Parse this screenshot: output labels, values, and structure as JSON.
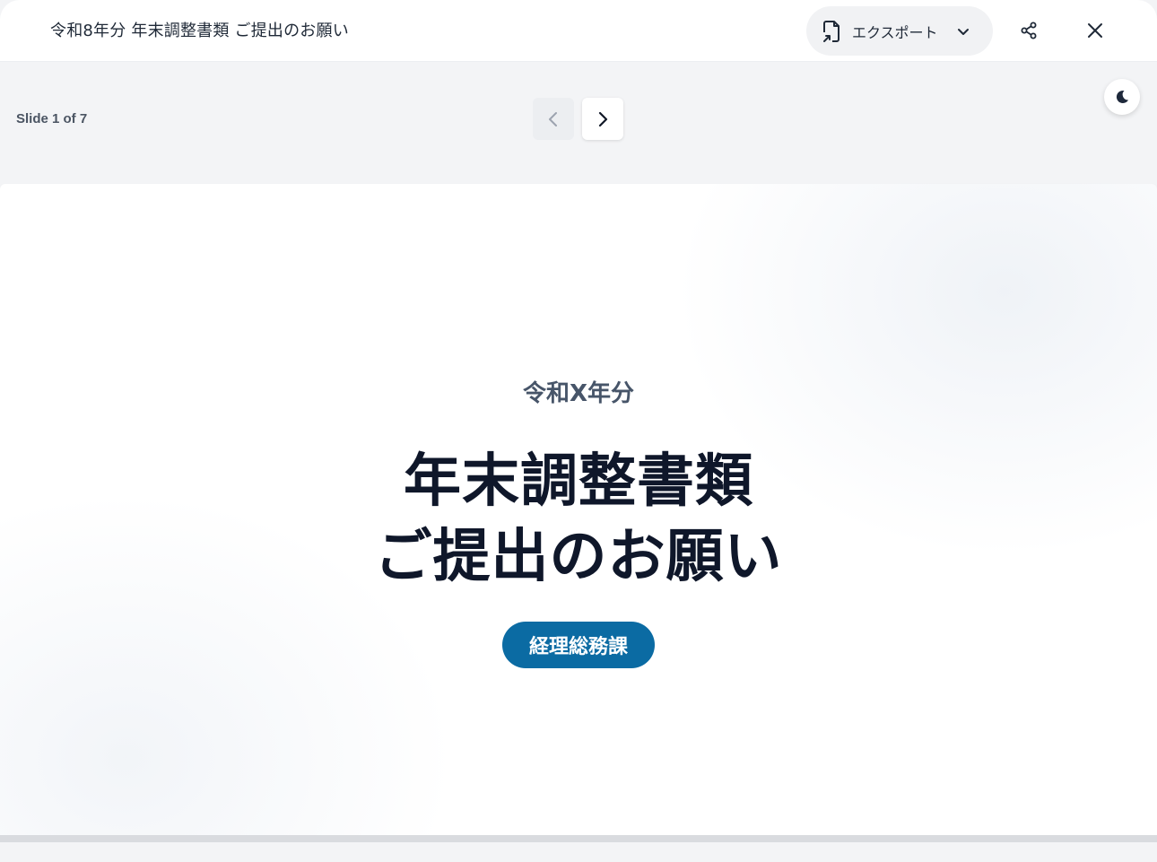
{
  "header": {
    "title": "令和8年分 年末調整書類 ご提出のお願い",
    "export_label": "エクスポート",
    "icons": [
      "file-export-icon",
      "chevron-down-icon",
      "share-icon",
      "close-icon"
    ]
  },
  "toolbar": {
    "slide_counter": "Slide 1 of 7",
    "icons": [
      "chevron-left-icon",
      "chevron-right-icon",
      "moon-icon"
    ]
  },
  "slide": {
    "kicker": "令和X年分",
    "headline_line1": "年末調整書類",
    "headline_line2": "ご提出のお願い",
    "department": "経理総務課"
  },
  "colors": {
    "accent": "#0b6ba3",
    "headline": "#0f172a",
    "kicker": "#475569",
    "background": "#f3f4f6"
  }
}
